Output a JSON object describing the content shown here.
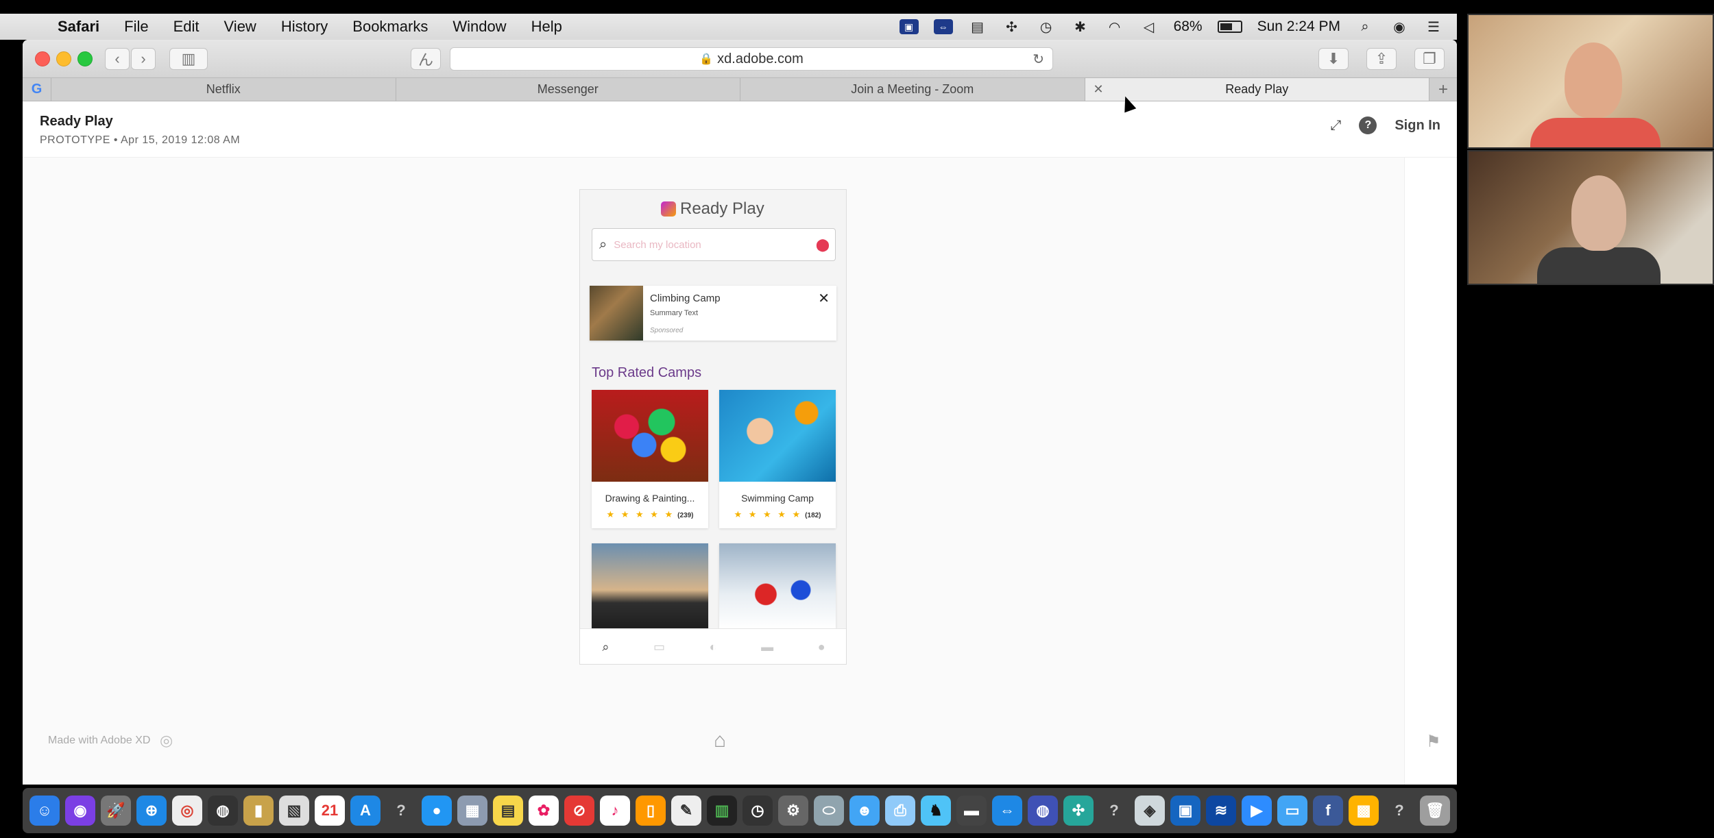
{
  "menubar": {
    "app_name": "Safari",
    "menus": [
      "File",
      "Edit",
      "View",
      "History",
      "Bookmarks",
      "Window",
      "Help"
    ],
    "battery_percent": "68%",
    "clock": "Sun 2:24 PM",
    "battery_level": 0.68
  },
  "browser": {
    "url": "xd.adobe.com",
    "tabs": [
      {
        "label": "Netflix"
      },
      {
        "label": "Messenger"
      },
      {
        "label": "Join a Meeting - Zoom"
      },
      {
        "label": "Ready Play"
      }
    ]
  },
  "xd": {
    "title": "Ready Play",
    "subtitle": "PROTOTYPE  •  Apr 15, 2019 12:08 AM",
    "sign_in": "Sign In",
    "made_with": "Made with Adobe XD"
  },
  "app": {
    "name": "Ready Play",
    "search_placeholder": "Search my location",
    "ad": {
      "title": "Climbing Camp",
      "summary": "Summary Text",
      "sponsored": "Sponsored"
    },
    "section_title": "Top Rated Camps",
    "camps": [
      {
        "name": "Drawing & Painting...",
        "stars": "★ ★ ★ ★ ★",
        "count": "(239)",
        "rating": 5
      },
      {
        "name": "Swimming Camp",
        "stars": "★ ★ ★ ★ ★",
        "count": "(182)",
        "rating": 5
      }
    ]
  },
  "colors": {
    "section_title": "#6b3a8a",
    "pin": "#e53955",
    "star": "#f5b301"
  }
}
